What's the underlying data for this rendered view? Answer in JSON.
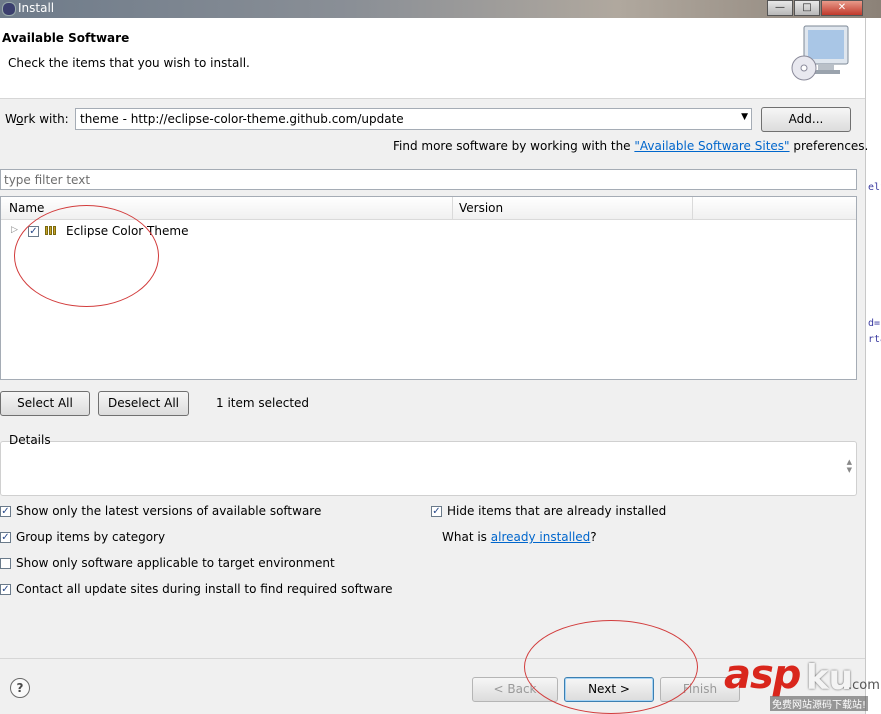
{
  "window": {
    "title": "Install"
  },
  "banner": {
    "title": "Available Software",
    "subtitle": "Check the items that you wish to install."
  },
  "work_with": {
    "label_before": "W",
    "label_underlined": "o",
    "label_after": "rk with:",
    "value": "theme - http://eclipse-color-theme.github.com/update",
    "add_button": "Add...",
    "find_more_before": "Find more software by working with the ",
    "find_more_link": "\"Available Software Sites\"",
    "find_more_after": " preferences."
  },
  "filter": {
    "placeholder": "type filter text"
  },
  "tree": {
    "columns": [
      "Name",
      "Version"
    ],
    "items": [
      {
        "label": "Eclipse Color Theme",
        "checked": true
      }
    ]
  },
  "selection": {
    "select_all": "Select All",
    "deselect_all": "Deselect All",
    "count_text": "1 item selected"
  },
  "details": {
    "label": "Details"
  },
  "options": {
    "latest": {
      "label": "Show only the latest versions of available software",
      "checked": true
    },
    "group": {
      "label": "Group items by category",
      "checked": true
    },
    "applicable": {
      "label": "Show only software applicable to target environment",
      "checked": false
    },
    "contact": {
      "label": "Contact all update sites during install to find required software",
      "checked": true
    },
    "hide": {
      "label": "Hide items that are already installed",
      "checked": true
    },
    "what_is_before": "What is ",
    "what_is_link": "already installed",
    "what_is_after": "?"
  },
  "footer": {
    "back": "< Back",
    "next": "Next >",
    "finish": "Finish"
  },
  "watermark": {
    "asp": "asp",
    "ku": "ku",
    "com": ".com",
    "cn": "免费网站源码下载站!"
  },
  "background_code": [
    "elf",
    "d=\"",
    "rta"
  ],
  "colors": {
    "annotation": "#d23c3c",
    "link": "#0066cc",
    "watermark_red": "#d9261c"
  },
  "icons": [
    "install-app-icon",
    "monitor-cd-icon",
    "dropdown-arrow-icon",
    "tree-expander-icon",
    "package-icon",
    "scroll-arrows-icon",
    "help-icon"
  ]
}
